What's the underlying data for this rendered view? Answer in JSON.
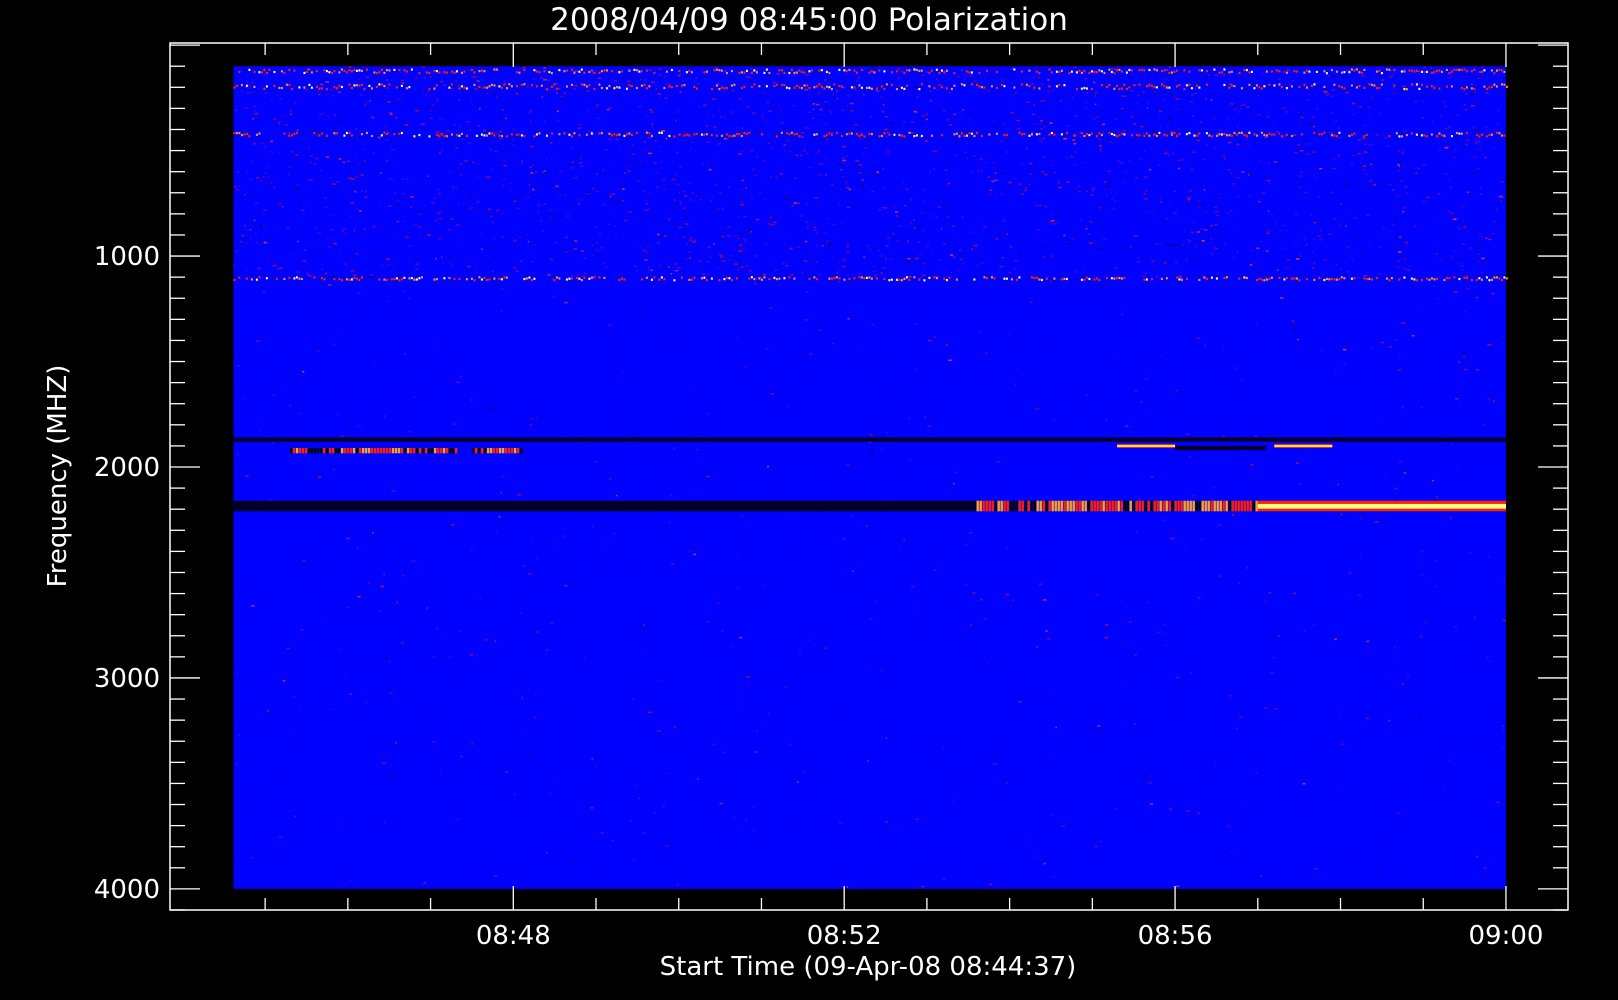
{
  "chart_data": {
    "type": "heatmap",
    "title": "2008/04/09 08:45:00 Polarization",
    "xlabel": "Start Time (09-Apr-08 08:44:37)",
    "ylabel": "Frequency (MHZ)",
    "x_tick_labels": [
      "08:48",
      "08:52",
      "08:56",
      "09:00"
    ],
    "x_tick_minutes": [
      48,
      52,
      56,
      60
    ],
    "x_range_minutes": [
      44.617,
      60.0
    ],
    "x_plot_range_minutes": [
      43.85,
      60.75
    ],
    "y_tick_labels": [
      "1000",
      "2000",
      "3000",
      "4000"
    ],
    "y_tick_values": [
      1000,
      2000,
      3000,
      4000
    ],
    "y_range": [
      100,
      4000
    ],
    "y_plot_range": [
      -10,
      4100
    ],
    "y_inverted": true,
    "colors": {
      "background": "#0000ff",
      "low": "#000000",
      "mid": "#ff2000",
      "high": "#ffff80"
    },
    "features": [
      {
        "f_from": 1860,
        "f_to": 1880,
        "t_from": 44.617,
        "t_to": 60.0,
        "kind": "dark"
      },
      {
        "f_from": 1890,
        "f_to": 1910,
        "t_from": 55.3,
        "t_to": 56.0,
        "kind": "bright"
      },
      {
        "f_from": 1890,
        "f_to": 1910,
        "t_from": 57.2,
        "t_to": 57.9,
        "kind": "bright"
      },
      {
        "f_from": 1900,
        "f_to": 1920,
        "t_from": 56.0,
        "t_to": 57.1,
        "kind": "dark"
      },
      {
        "f_from": 1910,
        "f_to": 1935,
        "t_from": 45.3,
        "t_to": 47.3,
        "kind": "mixed"
      },
      {
        "f_from": 1910,
        "f_to": 1935,
        "t_from": 47.5,
        "t_to": 48.1,
        "kind": "mixed"
      },
      {
        "f_from": 2160,
        "f_to": 2210,
        "t_from": 44.617,
        "t_to": 53.6,
        "kind": "dark"
      },
      {
        "f_from": 2160,
        "f_to": 2210,
        "t_from": 53.6,
        "t_to": 57.0,
        "kind": "mixed"
      },
      {
        "f_from": 2160,
        "f_to": 2210,
        "t_from": 57.0,
        "t_to": 60.0,
        "kind": "bright"
      },
      {
        "f_from": 1095,
        "f_to": 1120,
        "t_from": 44.617,
        "t_to": 60.0,
        "kind": "speckle"
      },
      {
        "f_from": 410,
        "f_to": 440,
        "t_from": 44.617,
        "t_to": 60.0,
        "kind": "speckle"
      },
      {
        "f_from": 180,
        "f_to": 220,
        "t_from": 44.617,
        "t_to": 60.0,
        "kind": "speckle"
      },
      {
        "f_from": 110,
        "f_to": 140,
        "t_from": 44.617,
        "t_to": 60.0,
        "kind": "speckle"
      }
    ]
  }
}
